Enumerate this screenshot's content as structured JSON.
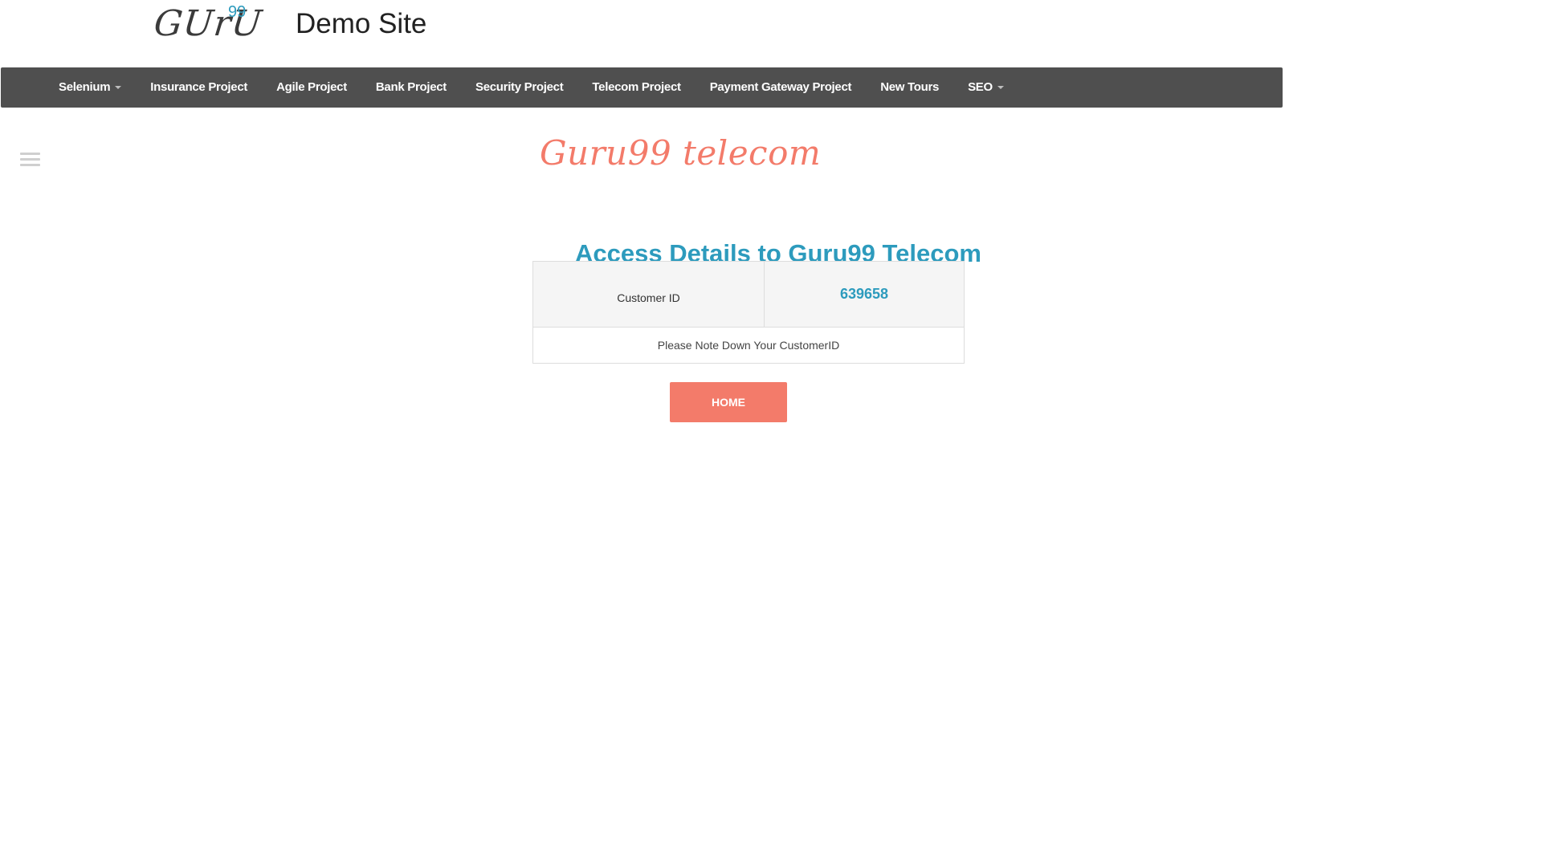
{
  "header": {
    "logo_text": "GUrU",
    "logo_superscript": "99",
    "site_title": "Demo Site"
  },
  "navbar": {
    "items": [
      {
        "label": "Selenium",
        "dropdown": true
      },
      {
        "label": "Insurance Project",
        "dropdown": false
      },
      {
        "label": "Agile Project",
        "dropdown": false
      },
      {
        "label": "Bank Project",
        "dropdown": false
      },
      {
        "label": "Security Project",
        "dropdown": false
      },
      {
        "label": "Telecom Project",
        "dropdown": false
      },
      {
        "label": "Payment Gateway Project",
        "dropdown": false
      },
      {
        "label": "New Tours",
        "dropdown": false
      },
      {
        "label": "SEO",
        "dropdown": true
      }
    ]
  },
  "sidebar": {
    "menu_icon": "hamburger-menu-icon"
  },
  "main": {
    "brand_title": "Guru99 telecom",
    "heading": "Access Details to Guru99 Telecom",
    "customer_id_label": "Customer ID",
    "customer_id_value": "639658",
    "note": "Please Note Down Your CustomerID",
    "home_button_label": "Home"
  },
  "colors": {
    "accent_blue": "#2d9bbd",
    "accent_coral": "#f37b6a",
    "navbar_bg": "#4f4f4f"
  }
}
